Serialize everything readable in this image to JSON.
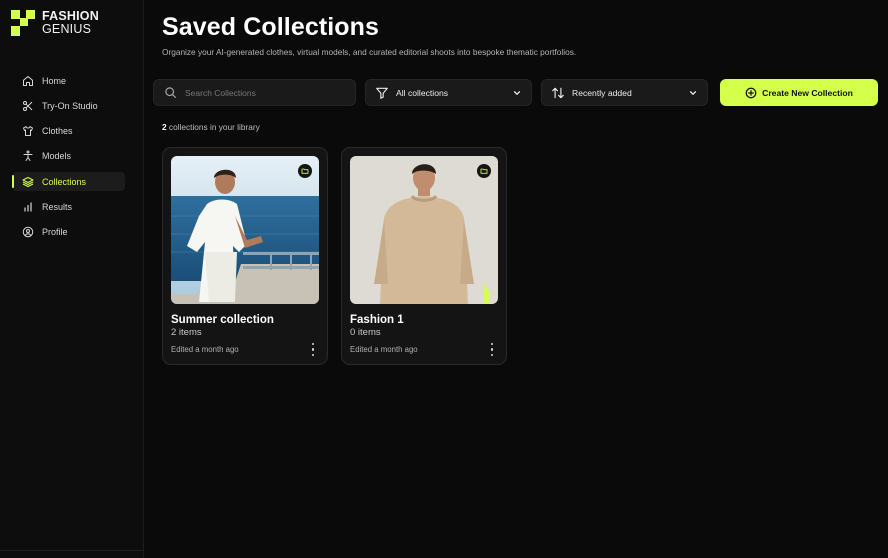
{
  "brand": {
    "line1": "FASHION",
    "line2": "GENIUS",
    "accent": "#d4ff4a"
  },
  "sidebar": {
    "items": [
      {
        "label": "Home",
        "icon": "home-icon"
      },
      {
        "label": "Try-On Studio",
        "icon": "scissors-icon"
      },
      {
        "label": "Clothes",
        "icon": "shirt-icon"
      },
      {
        "label": "Models",
        "icon": "person-icon"
      },
      {
        "label": "Collections",
        "icon": "layers-icon",
        "active": true
      },
      {
        "label": "Results",
        "icon": "bar-chart-icon"
      },
      {
        "label": "Profile",
        "icon": "user-circle-icon"
      }
    ]
  },
  "page": {
    "title": "Saved Collections",
    "subtitle": "Organize your AI-generated clothes, virtual models, and curated editorial shoots into bespoke thematic portfolios."
  },
  "toolbar": {
    "search_placeholder": "Search Collections",
    "search_value": "",
    "filter_value": "All collections",
    "sort_value": "Recently added",
    "create_label": "Create New Collection"
  },
  "library": {
    "count": "2",
    "count_suffix": " collections in your library"
  },
  "collections": [
    {
      "name": "Summer collection",
      "items": "2 items",
      "edited": "Edited a month ago"
    },
    {
      "name": "Fashion 1",
      "items": "0 items",
      "edited": "Edited a month ago"
    }
  ]
}
